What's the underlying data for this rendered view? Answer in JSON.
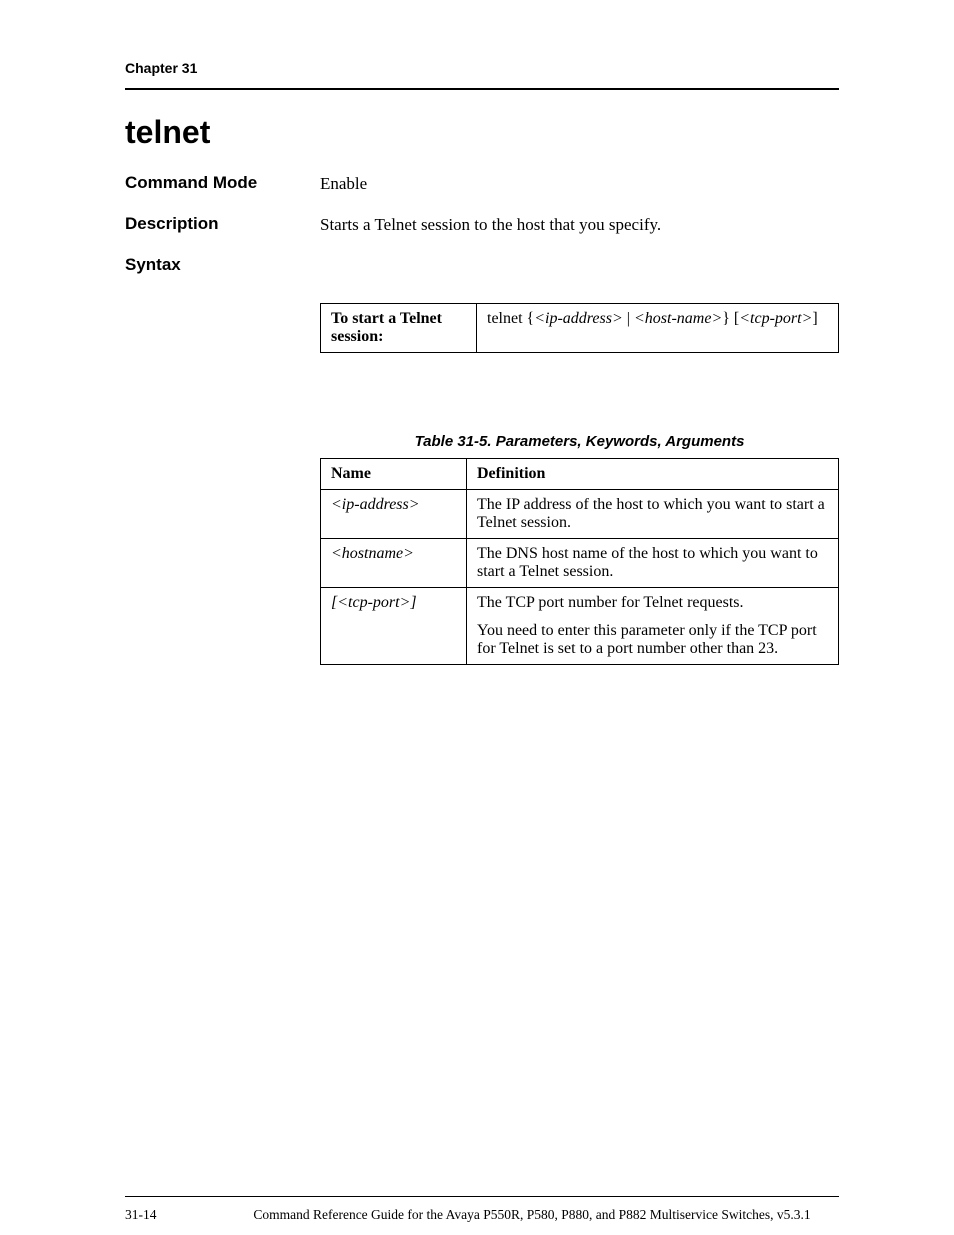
{
  "header": {
    "chapter": "Chapter 31"
  },
  "title": "telnet",
  "sections": {
    "command_mode_label": "Command Mode",
    "command_mode_value": "Enable",
    "description_label": "Description",
    "description_value": "Starts a Telnet session to the host that you specify.",
    "syntax_label": "Syntax"
  },
  "syntax_table": {
    "action": "To start a Telnet session:",
    "command_prefix": "telnet {",
    "p1": "<ip-address>",
    "sep1": " | ",
    "p2": "<host-name>",
    "mid": "} [",
    "p3": "<tcp-port>",
    "suffix": "]"
  },
  "param_caption": "Table 31-5.  Parameters, Keywords, Arguments",
  "param_headers": {
    "name": "Name",
    "definition": "Definition"
  },
  "params": [
    {
      "name": "<ip-address>",
      "def0": "The IP address of the host to which you want to start a Telnet session."
    },
    {
      "name": "<hostname>",
      "def0": "The DNS host name of the host to which you want to start a Telnet session."
    },
    {
      "name": "[<tcp-port>]",
      "def0": "The TCP port number for Telnet requests.",
      "def1": "You need to enter this parameter only if the TCP port for Telnet is set to a port number other than 23."
    }
  ],
  "footer": {
    "page_num": "31-14",
    "text": "Command Reference Guide for the Avaya P550R, P580, P880, and P882 Multiservice Switches, v5.3.1"
  }
}
